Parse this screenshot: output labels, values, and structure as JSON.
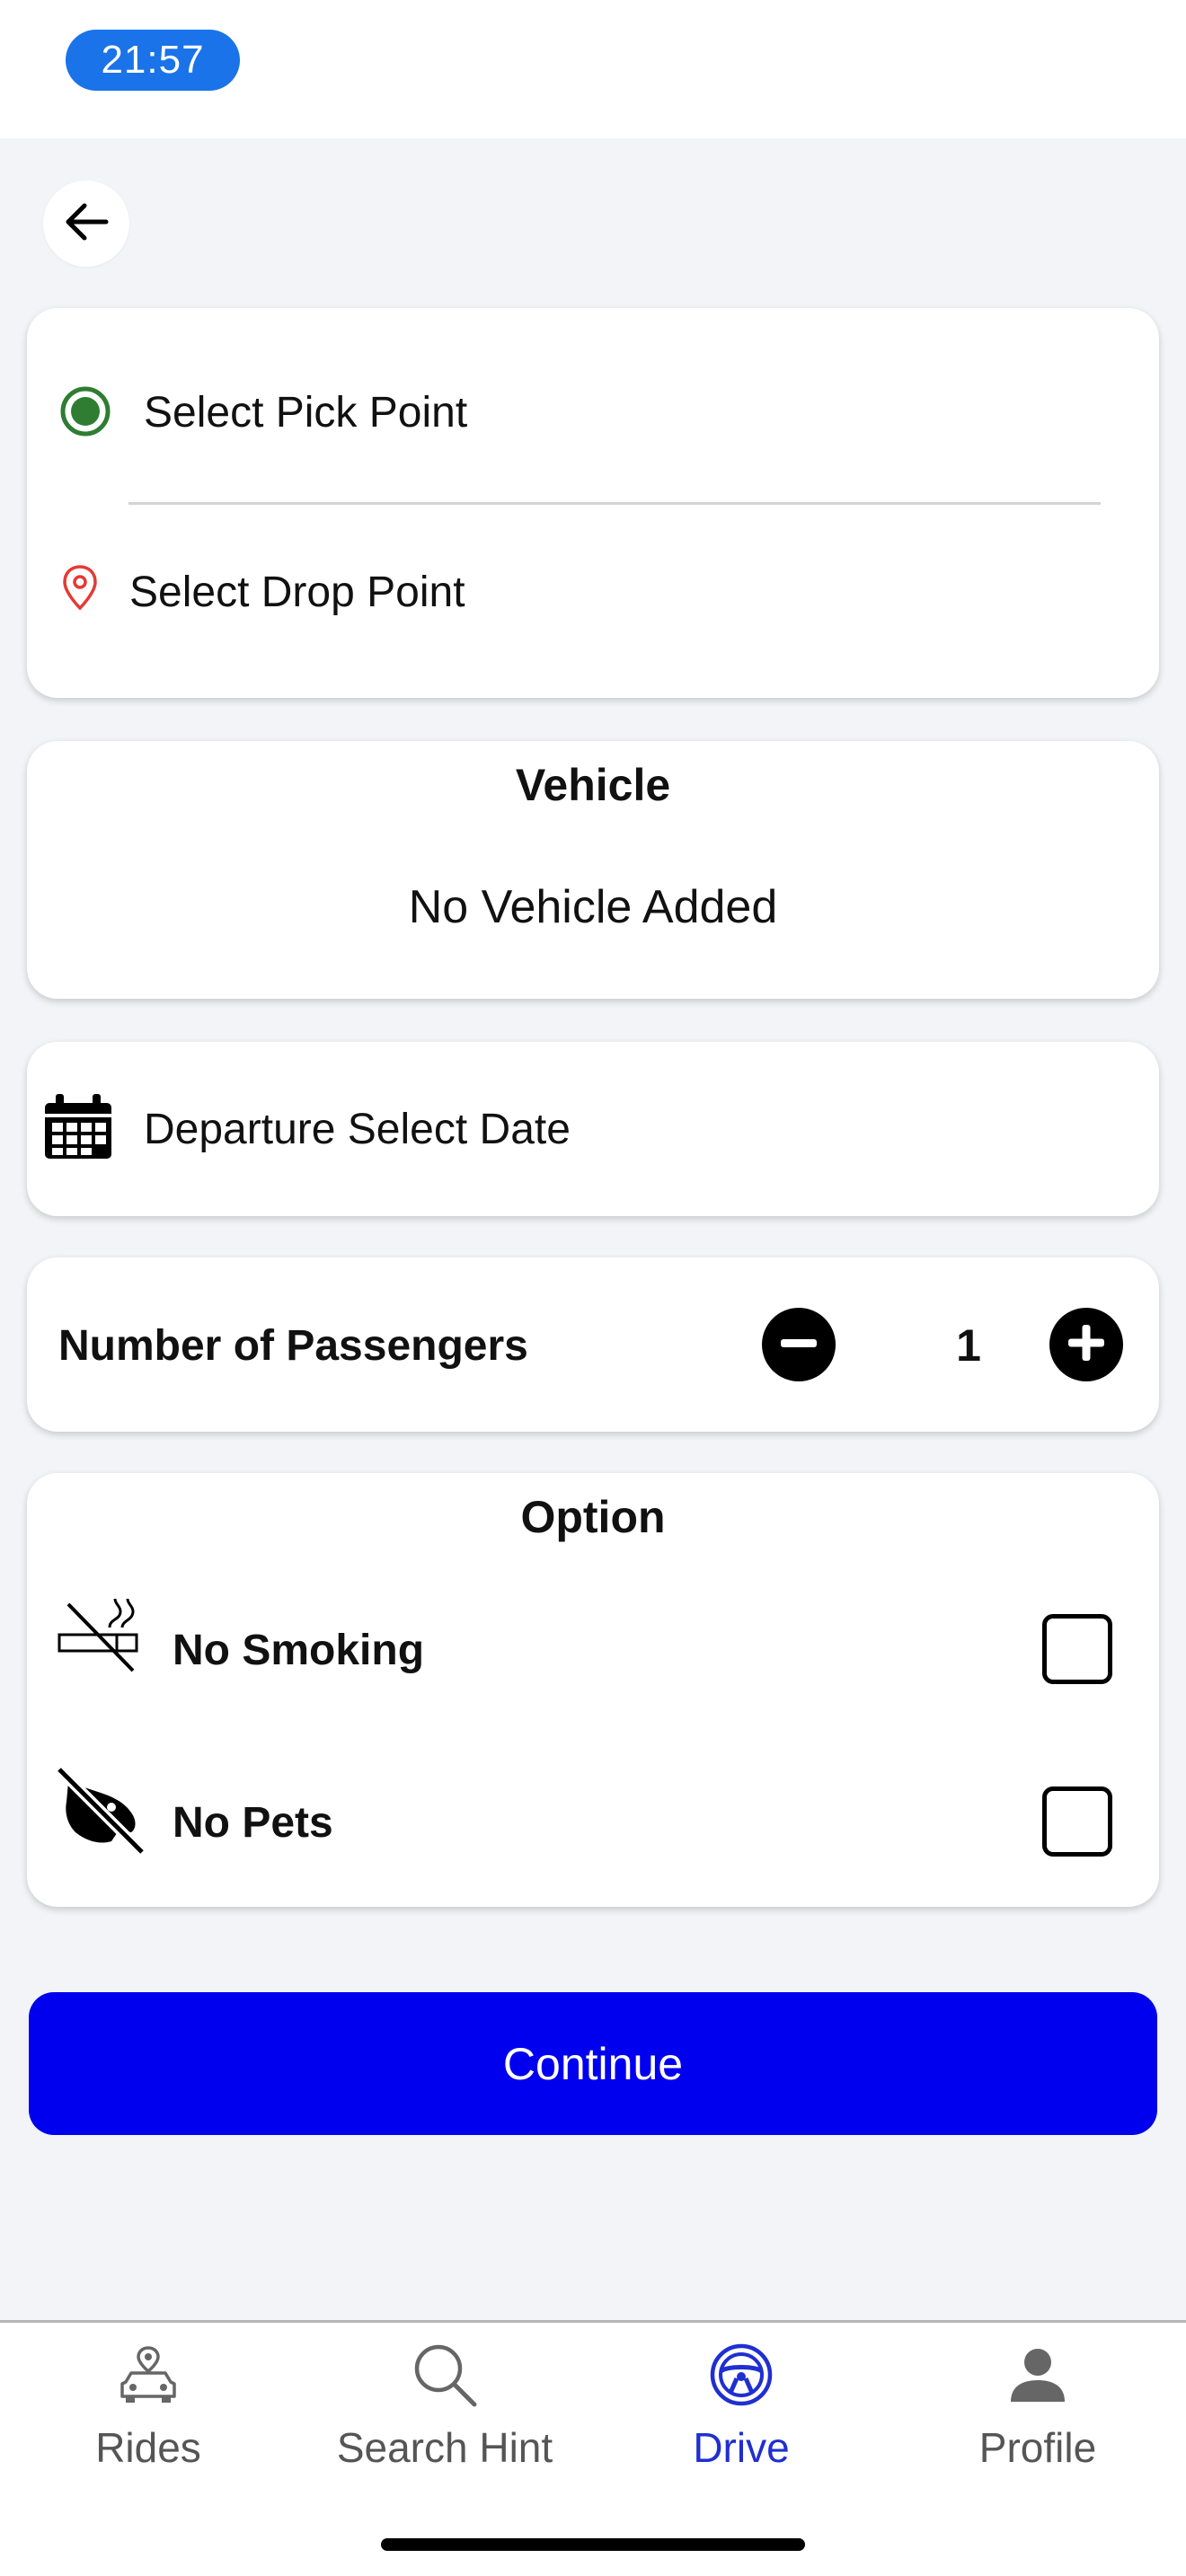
{
  "status_bar": {
    "time": "21:57"
  },
  "route": {
    "pick_label": "Select Pick Point",
    "drop_label": "Select Drop Point"
  },
  "vehicle": {
    "title": "Vehicle",
    "empty_text": "No Vehicle Added"
  },
  "departure": {
    "label": "Departure Select Date"
  },
  "passengers": {
    "label": "Number of Passengers",
    "count": "1"
  },
  "options": {
    "title": "Option",
    "items": [
      {
        "label": "No Smoking",
        "icon": "no-smoking-icon",
        "checked": false
      },
      {
        "label": "No Pets",
        "icon": "no-pets-icon",
        "checked": false
      }
    ]
  },
  "continue_label": "Continue",
  "tabs": [
    {
      "label": "Rides",
      "icon": "car-location-icon",
      "active": false
    },
    {
      "label": "Search Hint",
      "icon": "search-icon",
      "active": false
    },
    {
      "label": "Drive",
      "icon": "steering-wheel-icon",
      "active": true
    },
    {
      "label": "Profile",
      "icon": "person-icon",
      "active": false
    }
  ],
  "colors": {
    "accent": "#0000ee",
    "tab_active": "#1f2fd1",
    "pick_dot": "#2e7d32",
    "drop_pin": "#e53935",
    "time_pill": "#1a73e8"
  }
}
